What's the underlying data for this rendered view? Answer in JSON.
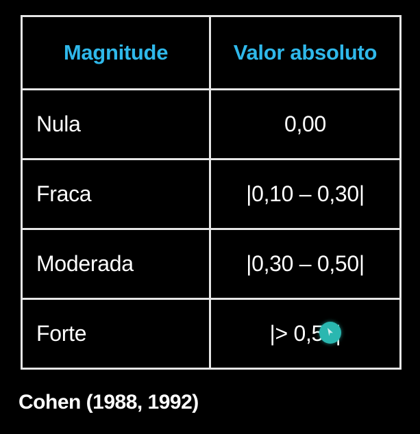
{
  "table": {
    "headers": [
      "Magnitude",
      "Valor absoluto"
    ],
    "rows": [
      {
        "magnitude": "Nula",
        "valor": "0,00"
      },
      {
        "magnitude": "Fraca",
        "valor": "|0,10 – 0,30|"
      },
      {
        "magnitude": "Moderada",
        "valor": "|0,30 – 0,50|"
      },
      {
        "magnitude": "Forte",
        "valor": "|> 0,50|"
      }
    ]
  },
  "citation": "Cohen (1988, 1992)",
  "colors": {
    "header_text": "#2fb8ea",
    "border": "#e6e6e6",
    "background": "#000000",
    "cursor": "#2ab7b0"
  }
}
